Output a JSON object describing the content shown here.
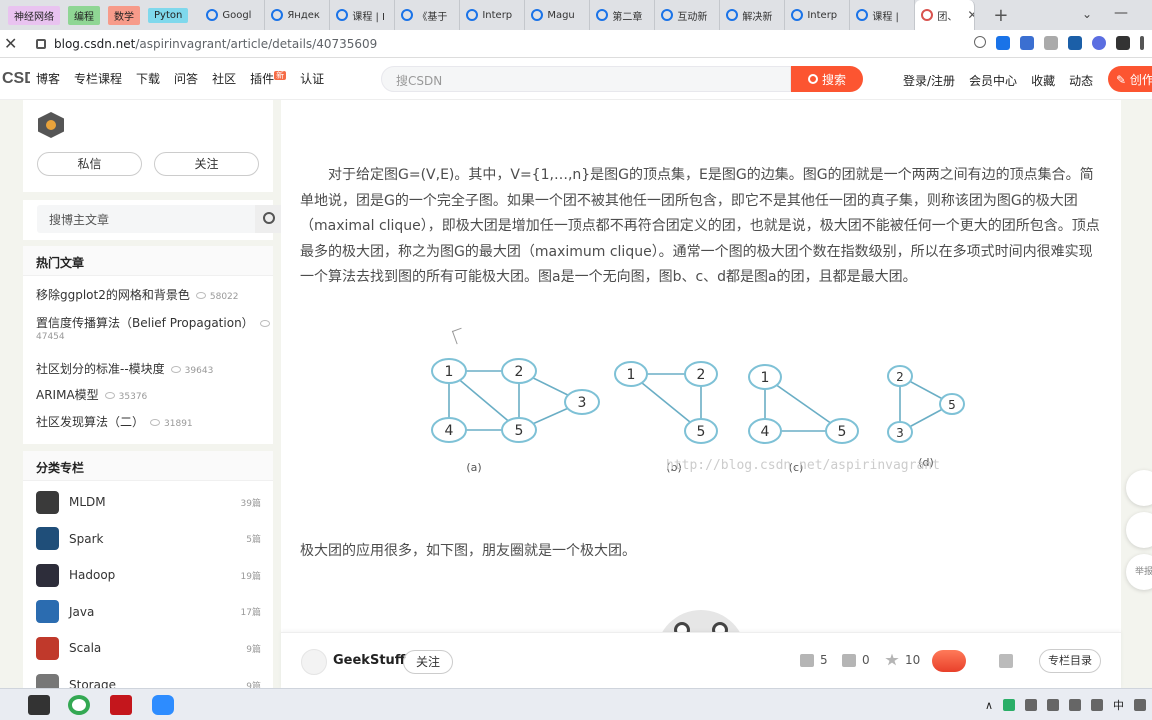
{
  "browser": {
    "bookmarks": [
      {
        "label": "神经网络",
        "color": "#e9c3f0"
      },
      {
        "label": "编程",
        "color": "#8fd694"
      },
      {
        "label": "数学",
        "color": "#f79b8a"
      },
      {
        "label": "Pyton",
        "color": "#7fd8ec"
      }
    ],
    "tabs": [
      {
        "label": "Googl"
      },
      {
        "label": "Яндек"
      },
      {
        "label": "课程 | I"
      },
      {
        "label": "《基于"
      },
      {
        "label": "Interp"
      },
      {
        "label": "Magu"
      },
      {
        "label": "第二章"
      },
      {
        "label": "互动新"
      },
      {
        "label": "解决新"
      },
      {
        "label": "Interp"
      },
      {
        "label": "课程 |"
      }
    ],
    "active_tab": "团、",
    "url_host": "blog.csdn.net",
    "url_path": "/aspirinvagrant/article/details/40735609"
  },
  "site": {
    "logo": "CSDN",
    "nav": [
      "博客",
      "专栏课程",
      "下载",
      "问答",
      "社区",
      "插件",
      "认证"
    ],
    "nav_hot_badge": "新",
    "search_placeholder": "搜CSDN",
    "search_button": "搜索",
    "header_right": [
      "登录/注册",
      "会员中心",
      "收藏",
      "动态"
    ],
    "create_button": "创作"
  },
  "sidebar": {
    "profile_buttons": {
      "message": "私信",
      "follow": "关注"
    },
    "search_placeholder": "搜博主文章",
    "hot_title": "热门文章",
    "hot_articles": [
      {
        "title": "移除ggplot2的网格和背景色",
        "views": "58022"
      },
      {
        "title": "置信度传播算法（Belief Propagation）",
        "views": "47454"
      },
      {
        "title": "社区划分的标准--模块度",
        "views": "39643"
      },
      {
        "title": "ARIMA模型",
        "views": "35376"
      },
      {
        "title": "社区发现算法（二）",
        "views": "31891"
      }
    ],
    "category_title": "分类专栏",
    "categories": [
      {
        "name": "MLDM",
        "count": "39篇",
        "color": "#3a3a3a"
      },
      {
        "name": "Spark",
        "count": "5篇",
        "color": "#1f4e79"
      },
      {
        "name": "Hadoop",
        "count": "19篇",
        "color": "#2d2d3a"
      },
      {
        "name": "Java",
        "count": "17篇",
        "color": "#2b6cb0"
      },
      {
        "name": "Scala",
        "count": "9篇",
        "color": "#c0392b"
      },
      {
        "name": "Storage",
        "count": "9篇",
        "color": "#777777"
      }
    ]
  },
  "article": {
    "paragraph1": "对于给定图G=(V,E)。其中，V={1,…,n}是图G的顶点集，E是图G的边集。图G的团就是一个两两之间有边的顶点集合。简单地说，团是G的一个完全子图。如果一个团不被其他任一团所包含，即它不是其他任一团的真子集，则称该团为图G的极大团（maximal clique），即极大团是增加任一顶点都不再符合团定义的团，也就是说，极大团不能被任何一个更大的团所包含。顶点最多的极大团，称之为图G的最大团（maximum clique）。通常一个图的极大团个数在指数级别，所以在多项式时间内很难实现一个算法去找到图的所有可能极大团。图a是一个无向图，图b、c、d都是图a的团，且都是最大团。",
    "paragraph2": "极大团的应用很多，如下图，朋友圈就是一个极大团。",
    "figure": {
      "captions": [
        "(a)",
        "(b)",
        "(c)",
        "(d)"
      ],
      "watermark": "http://blog.csdn.net/aspirinvagrant",
      "graphs": [
        {
          "nodes": [
            "1",
            "2",
            "3",
            "4",
            "5"
          ],
          "edges": [
            [
              "1",
              "2"
            ],
            [
              "1",
              "4"
            ],
            [
              "1",
              "5"
            ],
            [
              "2",
              "3"
            ],
            [
              "2",
              "5"
            ],
            [
              "3",
              "5"
            ],
            [
              "4",
              "5"
            ]
          ]
        },
        {
          "nodes": [
            "1",
            "2",
            "5"
          ],
          "edges": [
            [
              "1",
              "2"
            ],
            [
              "1",
              "5"
            ],
            [
              "2",
              "5"
            ]
          ]
        },
        {
          "nodes": [
            "1",
            "4",
            "5"
          ],
          "edges": [
            [
              "1",
              "4"
            ],
            [
              "1",
              "5"
            ],
            [
              "4",
              "5"
            ]
          ]
        },
        {
          "nodes": [
            "2",
            "5",
            "3"
          ],
          "edges": [
            [
              "2",
              "5"
            ],
            [
              "2",
              "3"
            ],
            [
              "3",
              "5"
            ]
          ]
        }
      ],
      "node_color": "#7ec1d6",
      "edge_color": "#6aaec5"
    }
  },
  "bottombar": {
    "author": "GeekStuff",
    "follow": "关注",
    "likes": "5",
    "comments": "0",
    "favorites": "10",
    "toc": "专栏目录"
  },
  "float_buttons": [
    "",
    "",
    "举报"
  ],
  "taskbar": {
    "tray_text": [
      "中"
    ]
  }
}
